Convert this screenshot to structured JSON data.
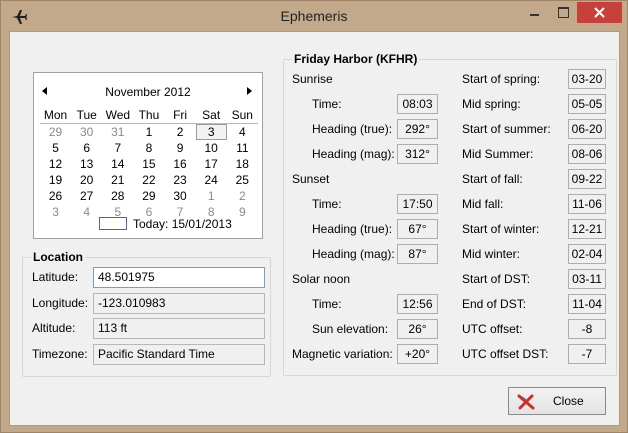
{
  "window": {
    "title": "Ephemeris"
  },
  "calendar": {
    "month_label": "November 2012",
    "weekdays": [
      "Mon",
      "Tue",
      "Wed",
      "Thu",
      "Fri",
      "Sat",
      "Sun"
    ],
    "weeks": [
      [
        "29",
        "30",
        "31",
        "1",
        "2",
        "3",
        "4"
      ],
      [
        "5",
        "6",
        "7",
        "8",
        "9",
        "10",
        "11"
      ],
      [
        "12",
        "13",
        "14",
        "15",
        "16",
        "17",
        "18"
      ],
      [
        "19",
        "20",
        "21",
        "22",
        "23",
        "24",
        "25"
      ],
      [
        "26",
        "27",
        "28",
        "29",
        "30",
        "1",
        "2"
      ],
      [
        "3",
        "4",
        "5",
        "6",
        "7",
        "8",
        "9"
      ]
    ],
    "other_month": [
      [
        true,
        true,
        true,
        false,
        false,
        false,
        false
      ],
      [
        false,
        false,
        false,
        false,
        false,
        false,
        false
      ],
      [
        false,
        false,
        false,
        false,
        false,
        false,
        false
      ],
      [
        false,
        false,
        false,
        false,
        false,
        false,
        false
      ],
      [
        false,
        false,
        false,
        false,
        false,
        true,
        true
      ],
      [
        true,
        true,
        true,
        true,
        true,
        true,
        true
      ]
    ],
    "selected_day": "3",
    "today_label": "Today: 15/01/2013"
  },
  "location": {
    "title": "Location",
    "latitude_label": "Latitude:",
    "latitude": "48.501975",
    "longitude_label": "Longitude:",
    "longitude": "-123.010983",
    "altitude_label": "Altitude:",
    "altitude": "113 ft",
    "timezone_label": "Timezone:",
    "timezone": "Pacific Standard Time"
  },
  "station": {
    "title": "Friday Harbor (KFHR)",
    "sunrise_label": "Sunrise",
    "sunrise_time_label": "Time:",
    "sunrise_time": "08:03",
    "sunrise_heading_true_label": "Heading (true):",
    "sunrise_heading_true": "292°",
    "sunrise_heading_mag_label": "Heading (mag):",
    "sunrise_heading_mag": "312°",
    "sunset_label": "Sunset",
    "sunset_time_label": "Time:",
    "sunset_time": "17:50",
    "sunset_heading_true_label": "Heading (true):",
    "sunset_heading_true": "67°",
    "sunset_heading_mag_label": "Heading (mag):",
    "sunset_heading_mag": "87°",
    "noon_label": "Solar noon",
    "noon_time_label": "Time:",
    "noon_time": "12:56",
    "noon_elevation_label": "Sun elevation:",
    "noon_elevation": "26°",
    "magvar_label": "Magnetic variation:",
    "magvar": "+20°",
    "seasons": [
      {
        "label": "Start of spring:",
        "value": "03-20"
      },
      {
        "label": "Mid spring:",
        "value": "05-05"
      },
      {
        "label": "Start of summer:",
        "value": "06-20"
      },
      {
        "label": "Mid Summer:",
        "value": "08-06"
      },
      {
        "label": "Start of fall:",
        "value": "09-22"
      },
      {
        "label": "Mid fall:",
        "value": "11-06"
      },
      {
        "label": "Start of winter:",
        "value": "12-21"
      },
      {
        "label": "Mid winter:",
        "value": "02-04"
      },
      {
        "label": "Start of DST:",
        "value": "03-11"
      },
      {
        "label": "End of DST:",
        "value": "11-04"
      },
      {
        "label": "UTC offset:",
        "value": "-8"
      },
      {
        "label": "UTC offset DST:",
        "value": "-7"
      }
    ]
  },
  "buttons": {
    "close_label": "Close"
  },
  "icons": {
    "app": "airplane-icon",
    "close_button": "red-x-icon"
  },
  "colors": {
    "titlebar": "#c3a98b",
    "close_accent": "#c7403a"
  }
}
